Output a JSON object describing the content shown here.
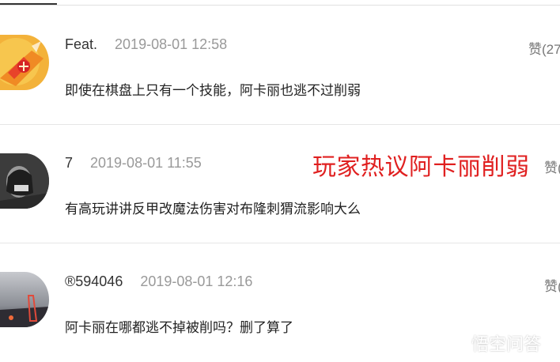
{
  "comments": [
    {
      "username": "Feat.",
      "time": "2019-08-01 12:58",
      "like": "赞(27",
      "text": "即使在棋盘上只有一个技能，阿卡丽也逃不过削弱"
    },
    {
      "username": "7",
      "time": "2019-08-01 11:55",
      "like": "赞(",
      "text": "有高玩讲讲反甲改魔法伤害对布隆刺猬流影响大么"
    },
    {
      "username": "®594046",
      "time": "2019-08-01 12:16",
      "like": "赞(",
      "text": "阿卡丽在哪都逃不掉被削吗？删了算了"
    }
  ],
  "overlay": {
    "title": "玩家热议阿卡丽削弱",
    "color": "#e02020"
  },
  "watermark": {
    "text": "悟空问答"
  }
}
